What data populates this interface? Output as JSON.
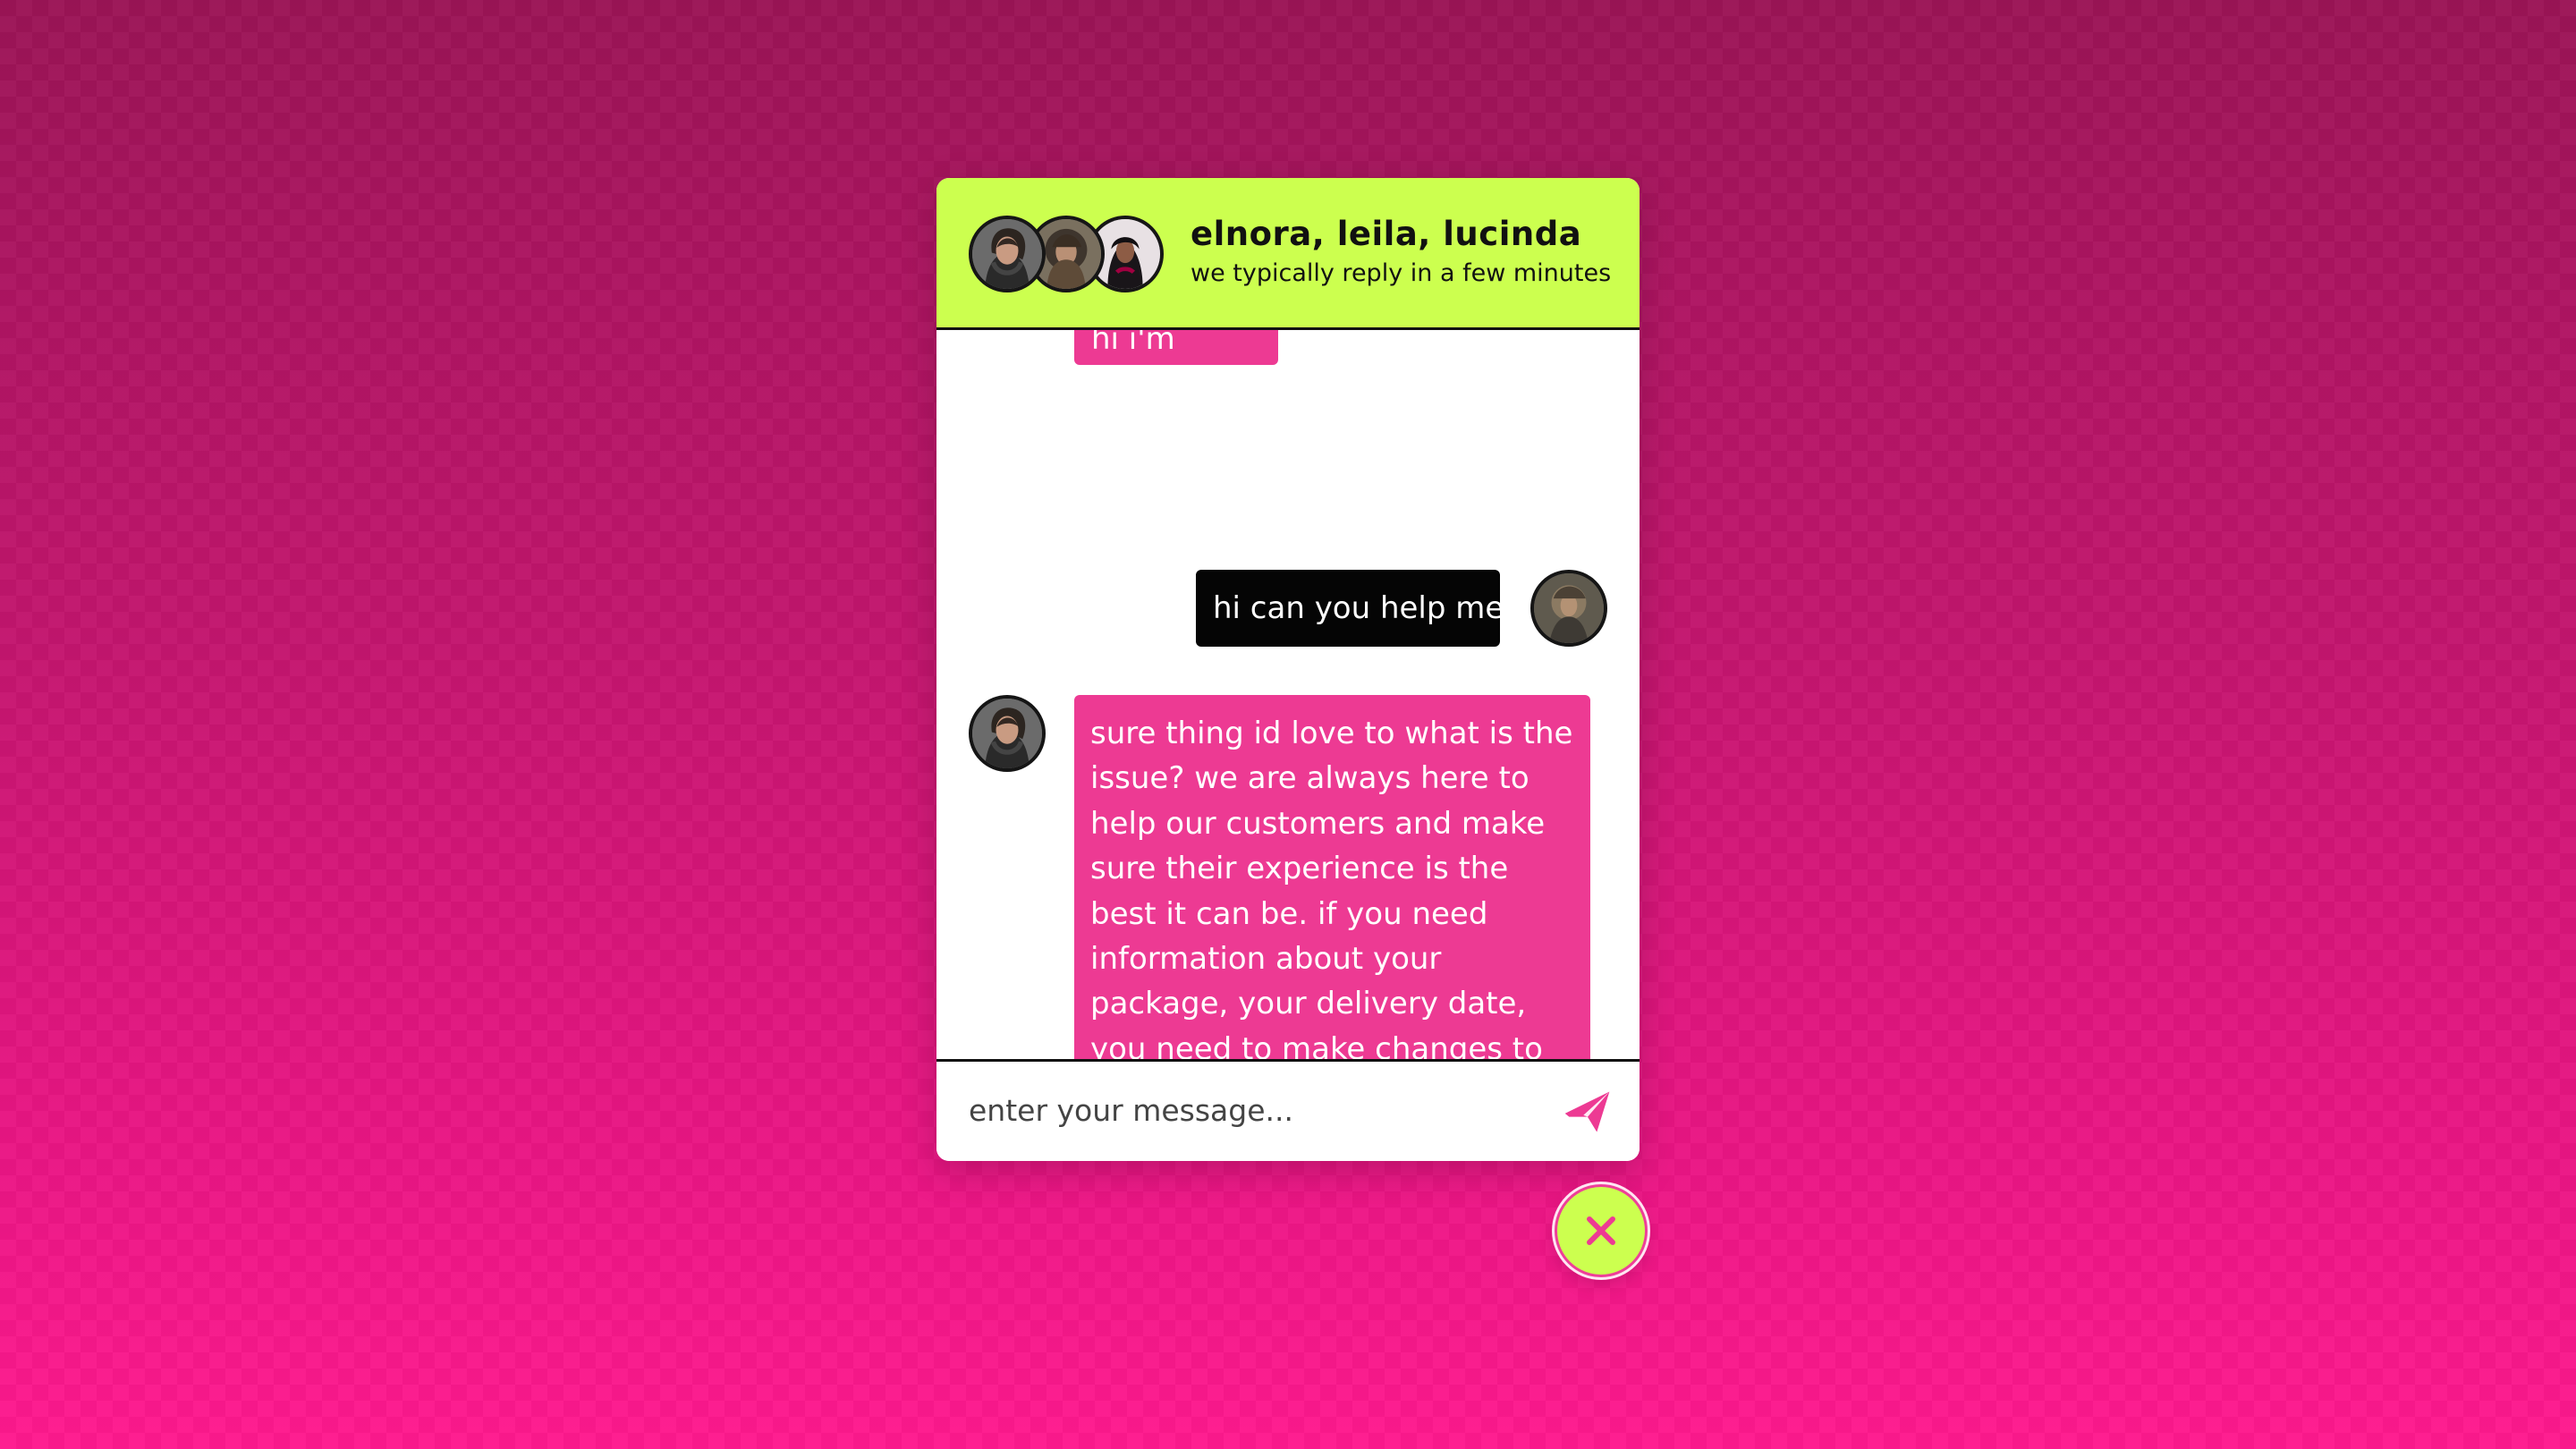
{
  "header": {
    "title": "elnora, leila, lucinda",
    "subtitle": "we typically reply in a few minutes"
  },
  "messages": [
    {
      "role": "agent",
      "text": "hi i'm elnora"
    },
    {
      "role": "user",
      "text": "hi can you help me"
    },
    {
      "role": "agent",
      "text": "sure thing id love to what is the issue? we are always here to help our customers and make sure their experience is the best it can be. if you need information about your package, your delivery date, you need to make changes to your order (if it has not shipped yet), or anything else you need, we are your girls!"
    }
  ],
  "composer": {
    "placeholder": "enter your message..."
  },
  "icons": {
    "send": "send-icon",
    "close": "close-icon"
  },
  "colors": {
    "header_background": "#ccff4f",
    "agent_bubble": "#ed3a93",
    "user_bubble": "#050505",
    "page_gradient_top": "#9b1456",
    "page_gradient_bottom": "#ff1a8e"
  }
}
